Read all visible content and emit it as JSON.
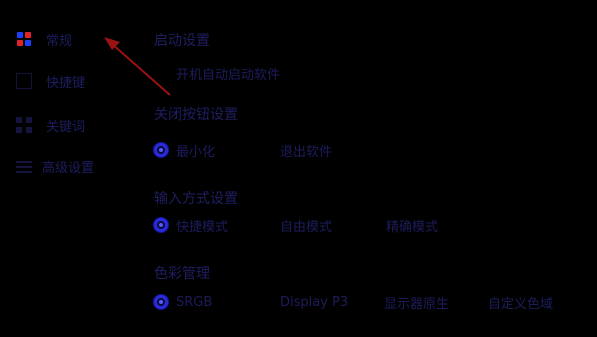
{
  "sidebar": {
    "items": [
      {
        "label": "常规",
        "icon": "app-logo-icon"
      },
      {
        "label": "快捷键",
        "icon": "keyboard-icon"
      },
      {
        "label": "关键词",
        "icon": "grid-icon"
      },
      {
        "label": "高级设置",
        "icon": "list-icon"
      }
    ]
  },
  "sections": {
    "startup": {
      "title": "启动设置",
      "option": "开机自动启动软件"
    },
    "close_button": {
      "title": "关闭按钮设置",
      "options": [
        "最小化",
        "退出软件"
      ],
      "selected": "最小化"
    },
    "input_mode": {
      "title": "输入方式设置",
      "options": [
        "快捷模式",
        "自由模式",
        "精确模式"
      ],
      "selected": "快捷模式"
    },
    "color_management": {
      "title": "色彩管理",
      "options": [
        "SRGB",
        "Display P3",
        "显示器原生",
        "自定义色域"
      ],
      "selected": "SRGB"
    }
  },
  "colors": {
    "background": "#000000",
    "text": "#1d1d60",
    "radio_accent": "#2a2ad8",
    "arrow": "#9a1313"
  }
}
